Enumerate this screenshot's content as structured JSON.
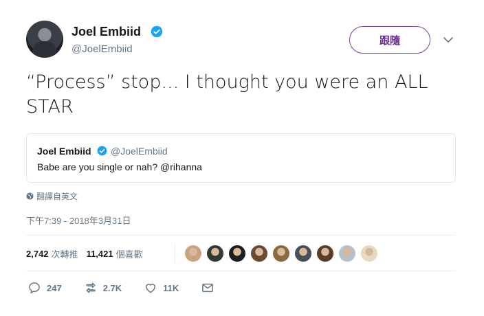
{
  "author": {
    "name": "Joel Embiid",
    "handle": "@JoelEmbiid"
  },
  "follow_button": {
    "label": "跟隨"
  },
  "tweet": {
    "text": "“Process” stop... I thought you were an ALL STAR"
  },
  "quoted_tweet": {
    "name": "Joel Embiid",
    "handle": "@JoelEmbiid",
    "text": "Babe are you single or nah? @rihanna"
  },
  "translate_label": "翻譯自英文",
  "timestamp": "下午7:39 - 2018年3月31日",
  "stats": {
    "retweets_count": "2,742",
    "retweets_label": "次轉推",
    "likes_count": "11,421",
    "likes_label": "個喜歡"
  },
  "liker_avatars": [
    "#c9a27e",
    "#2f3a30",
    "#1e1e1e",
    "#6b4a33",
    "#8a6b3f",
    "#4a4f56",
    "#5b3b2a",
    "#b8c0c8",
    "#e7d9c4"
  ],
  "actions": {
    "replies": "247",
    "retweets": "2.7K",
    "likes": "11K"
  },
  "colors": {
    "accent": "#1da1f2",
    "follow_border": "#7b3fa0",
    "muted": "#657786"
  },
  "icons": [
    "verified-badge-icon",
    "chevron-down-icon",
    "globe-icon",
    "reply-icon",
    "retweet-icon",
    "heart-icon",
    "message-icon"
  ]
}
